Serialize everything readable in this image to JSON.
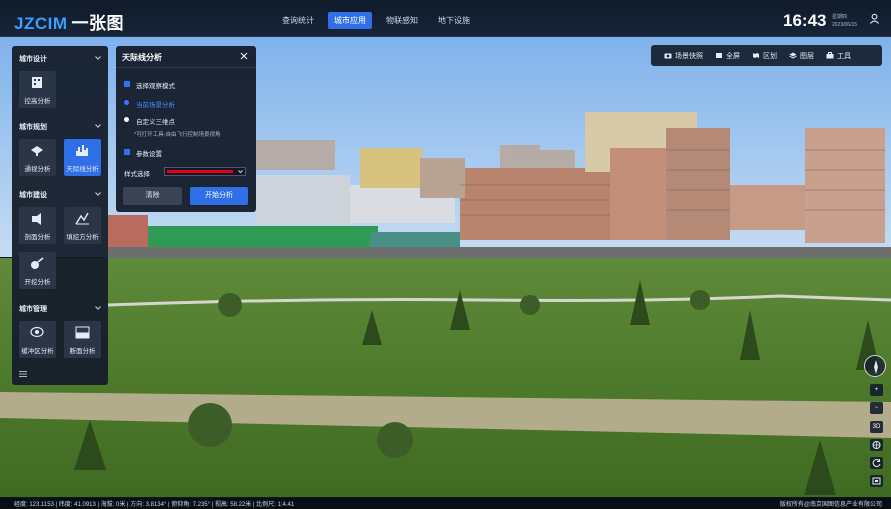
{
  "header": {
    "logo_brand": "JZCIM",
    "logo_text": "一张图",
    "nav": [
      {
        "label": "查询统计",
        "active": false
      },
      {
        "label": "城市应用",
        "active": true
      },
      {
        "label": "物联感知",
        "active": false
      },
      {
        "label": "地下设施",
        "active": false
      }
    ],
    "time": "16:43",
    "weekday": "星期四",
    "date": "2023/06/15"
  },
  "toolbar": [
    {
      "label": "场景快照",
      "icon": "camera-icon"
    },
    {
      "label": "全屏",
      "icon": "fullscreen-icon"
    },
    {
      "label": "区划",
      "icon": "map-icon"
    },
    {
      "label": "图层",
      "icon": "layers-icon"
    },
    {
      "label": "工具",
      "icon": "toolbox-icon"
    }
  ],
  "sidebar": {
    "sections": [
      {
        "title": "城市设计",
        "items": [
          {
            "label": "控高分析",
            "icon": "height-control-icon",
            "active": false
          }
        ]
      },
      {
        "title": "城市规划",
        "items": [
          {
            "label": "通视分析",
            "icon": "visibility-icon",
            "active": false
          },
          {
            "label": "天际线分析",
            "icon": "skyline-icon",
            "active": true
          }
        ]
      },
      {
        "title": "城市建设",
        "items": [
          {
            "label": "剖面分析",
            "icon": "profile-icon",
            "active": false
          },
          {
            "label": "填挖方分析",
            "icon": "cut-fill-icon",
            "active": false
          },
          {
            "label": "开挖分析",
            "icon": "excavation-icon",
            "active": false
          }
        ]
      },
      {
        "title": "城市管理",
        "items": [
          {
            "label": "缓冲区分析",
            "icon": "buffer-icon",
            "active": false
          },
          {
            "label": "断面分析",
            "icon": "section-icon",
            "active": false
          }
        ]
      }
    ]
  },
  "dialog": {
    "title": "天际线分析",
    "section1": "选择观察模式",
    "option_current": "当前场景分析",
    "option_custom": "自定义三维点",
    "hint": "*可打开工具-自由飞行控制场景视角",
    "section2": "参数设置",
    "style_label": "样式选择",
    "style_color": "#e0001a",
    "clear_button": "清除",
    "start_button": "开始分析"
  },
  "map_controls": {
    "zoom_in": "+",
    "zoom_out": "−",
    "mode_3d": "3D"
  },
  "status": {
    "text": "经度: 123.1153 | 纬度: 41.0913 | 海拔: 0米 | 方向: 3.8134° | 俯仰角: 7.235° | 视高: 58.22米 | 比例尺: 1:4.41",
    "copyright": "版权所有@南京国图信息产业有限公司"
  }
}
